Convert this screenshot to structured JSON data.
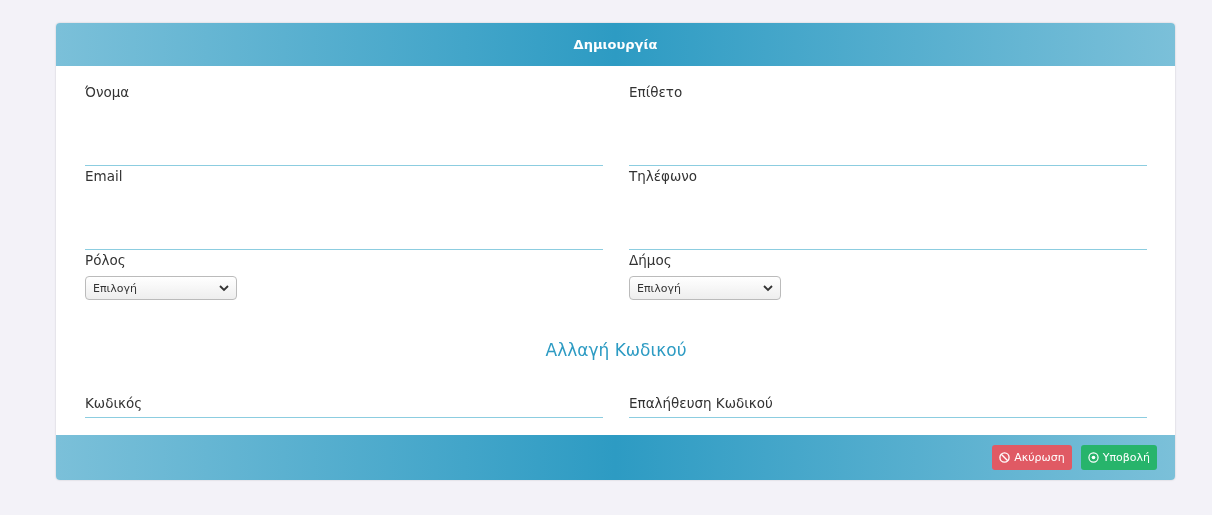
{
  "header": {
    "title": "Δημιουργία"
  },
  "fields": [
    {
      "kind": "text",
      "label": "Όνομα"
    },
    {
      "kind": "text",
      "label": "Επίθετο"
    },
    {
      "kind": "text",
      "label": "Email"
    },
    {
      "kind": "text",
      "label": "Τηλέφωνο"
    },
    {
      "kind": "select",
      "label": "Ρόλος",
      "value": "Επιλογή"
    },
    {
      "kind": "select",
      "label": "Δήμος",
      "value": "Επιλογή"
    }
  ],
  "password_section": {
    "title": "Αλλαγή Κωδικού",
    "fields": [
      {
        "placeholder": "Κωδικός"
      },
      {
        "placeholder": "Επαλήθευση Κωδικού"
      }
    ]
  },
  "buttons": [
    {
      "kind": "cancel",
      "label": "Ακύρωση"
    },
    {
      "kind": "submit",
      "label": "Υποβολή"
    }
  ]
}
